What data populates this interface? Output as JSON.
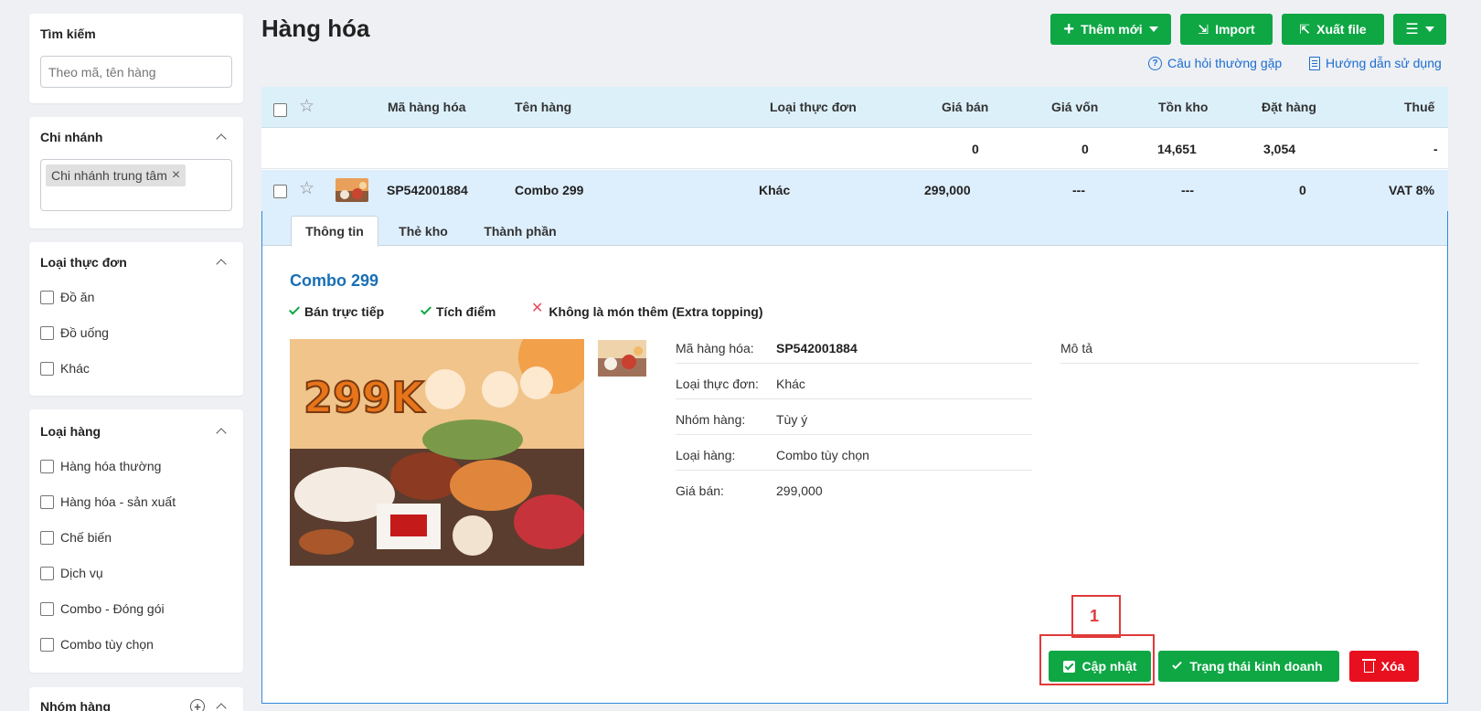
{
  "page_title": "Hàng hóa",
  "sidebar": {
    "search": {
      "title": "Tìm kiếm",
      "placeholder": "Theo mã, tên hàng"
    },
    "branch": {
      "title": "Chi nhánh",
      "tag": "Chi nhánh trung tâm"
    },
    "menu_type": {
      "title": "Loại thực đơn",
      "options": [
        "Đồ ăn",
        "Đồ uống",
        "Khác"
      ]
    },
    "item_type": {
      "title": "Loại hàng",
      "options": [
        "Hàng hóa thường",
        "Hàng hóa - sản xuất",
        "Chế biến",
        "Dịch vụ",
        "Combo - Đóng gói",
        "Combo tùy chọn"
      ]
    },
    "group": {
      "title": "Nhóm hàng"
    }
  },
  "toolbar": {
    "add_label": "Thêm mới",
    "import_label": "Import",
    "export_label": "Xuất file",
    "faq_label": "Câu hỏi thường gặp",
    "guide_label": "Hướng dẫn sử dụng"
  },
  "table": {
    "headers": [
      "Mã hàng hóa",
      "Tên hàng",
      "Loại thực đơn",
      "Giá bán",
      "Giá vốn",
      "Tồn kho",
      "Đặt hàng",
      "Thuế"
    ],
    "summary": {
      "gia_ban": "0",
      "gia_von": "0",
      "ton_kho": "14,651",
      "dat_hang": "3,054",
      "thue": "-"
    },
    "row": {
      "code": "SP542001884",
      "name": "Combo 299",
      "menu_type": "Khác",
      "price": "299,000",
      "cost": "---",
      "stock": "---",
      "ordered": "0",
      "tax": "VAT 8%"
    }
  },
  "detail": {
    "tabs": [
      "Thông tin",
      "Thẻ kho",
      "Thành phần"
    ],
    "title": "Combo 299",
    "flags": [
      {
        "label": "Bán trực tiếp",
        "state": "yes"
      },
      {
        "label": "Tích điểm",
        "state": "yes"
      },
      {
        "label": "Không là món thêm (Extra topping)",
        "state": "no"
      }
    ],
    "image_text": "299K",
    "fields": [
      {
        "label": "Mã hàng hóa:",
        "value": "SP542001884"
      },
      {
        "label": "Loại thực đơn:",
        "value": "Khác"
      },
      {
        "label": "Nhóm hàng:",
        "value": "Tùy ý"
      },
      {
        "label": "Loại hàng:",
        "value": "Combo tùy chọn"
      },
      {
        "label": "Giá bán:",
        "value": "299,000"
      }
    ],
    "description_label": "Mô tả",
    "buttons": {
      "update": "Cập nhật",
      "status": "Trạng thái kinh doanh",
      "delete": "Xóa"
    }
  },
  "annotation": {
    "number": "1",
    "color": "#e03a3a"
  },
  "colors": {
    "primary_green": "#0ea744",
    "danger_red": "#e8101e",
    "link_blue": "#1c6dd0",
    "header_bg": "#dcf0fa"
  }
}
